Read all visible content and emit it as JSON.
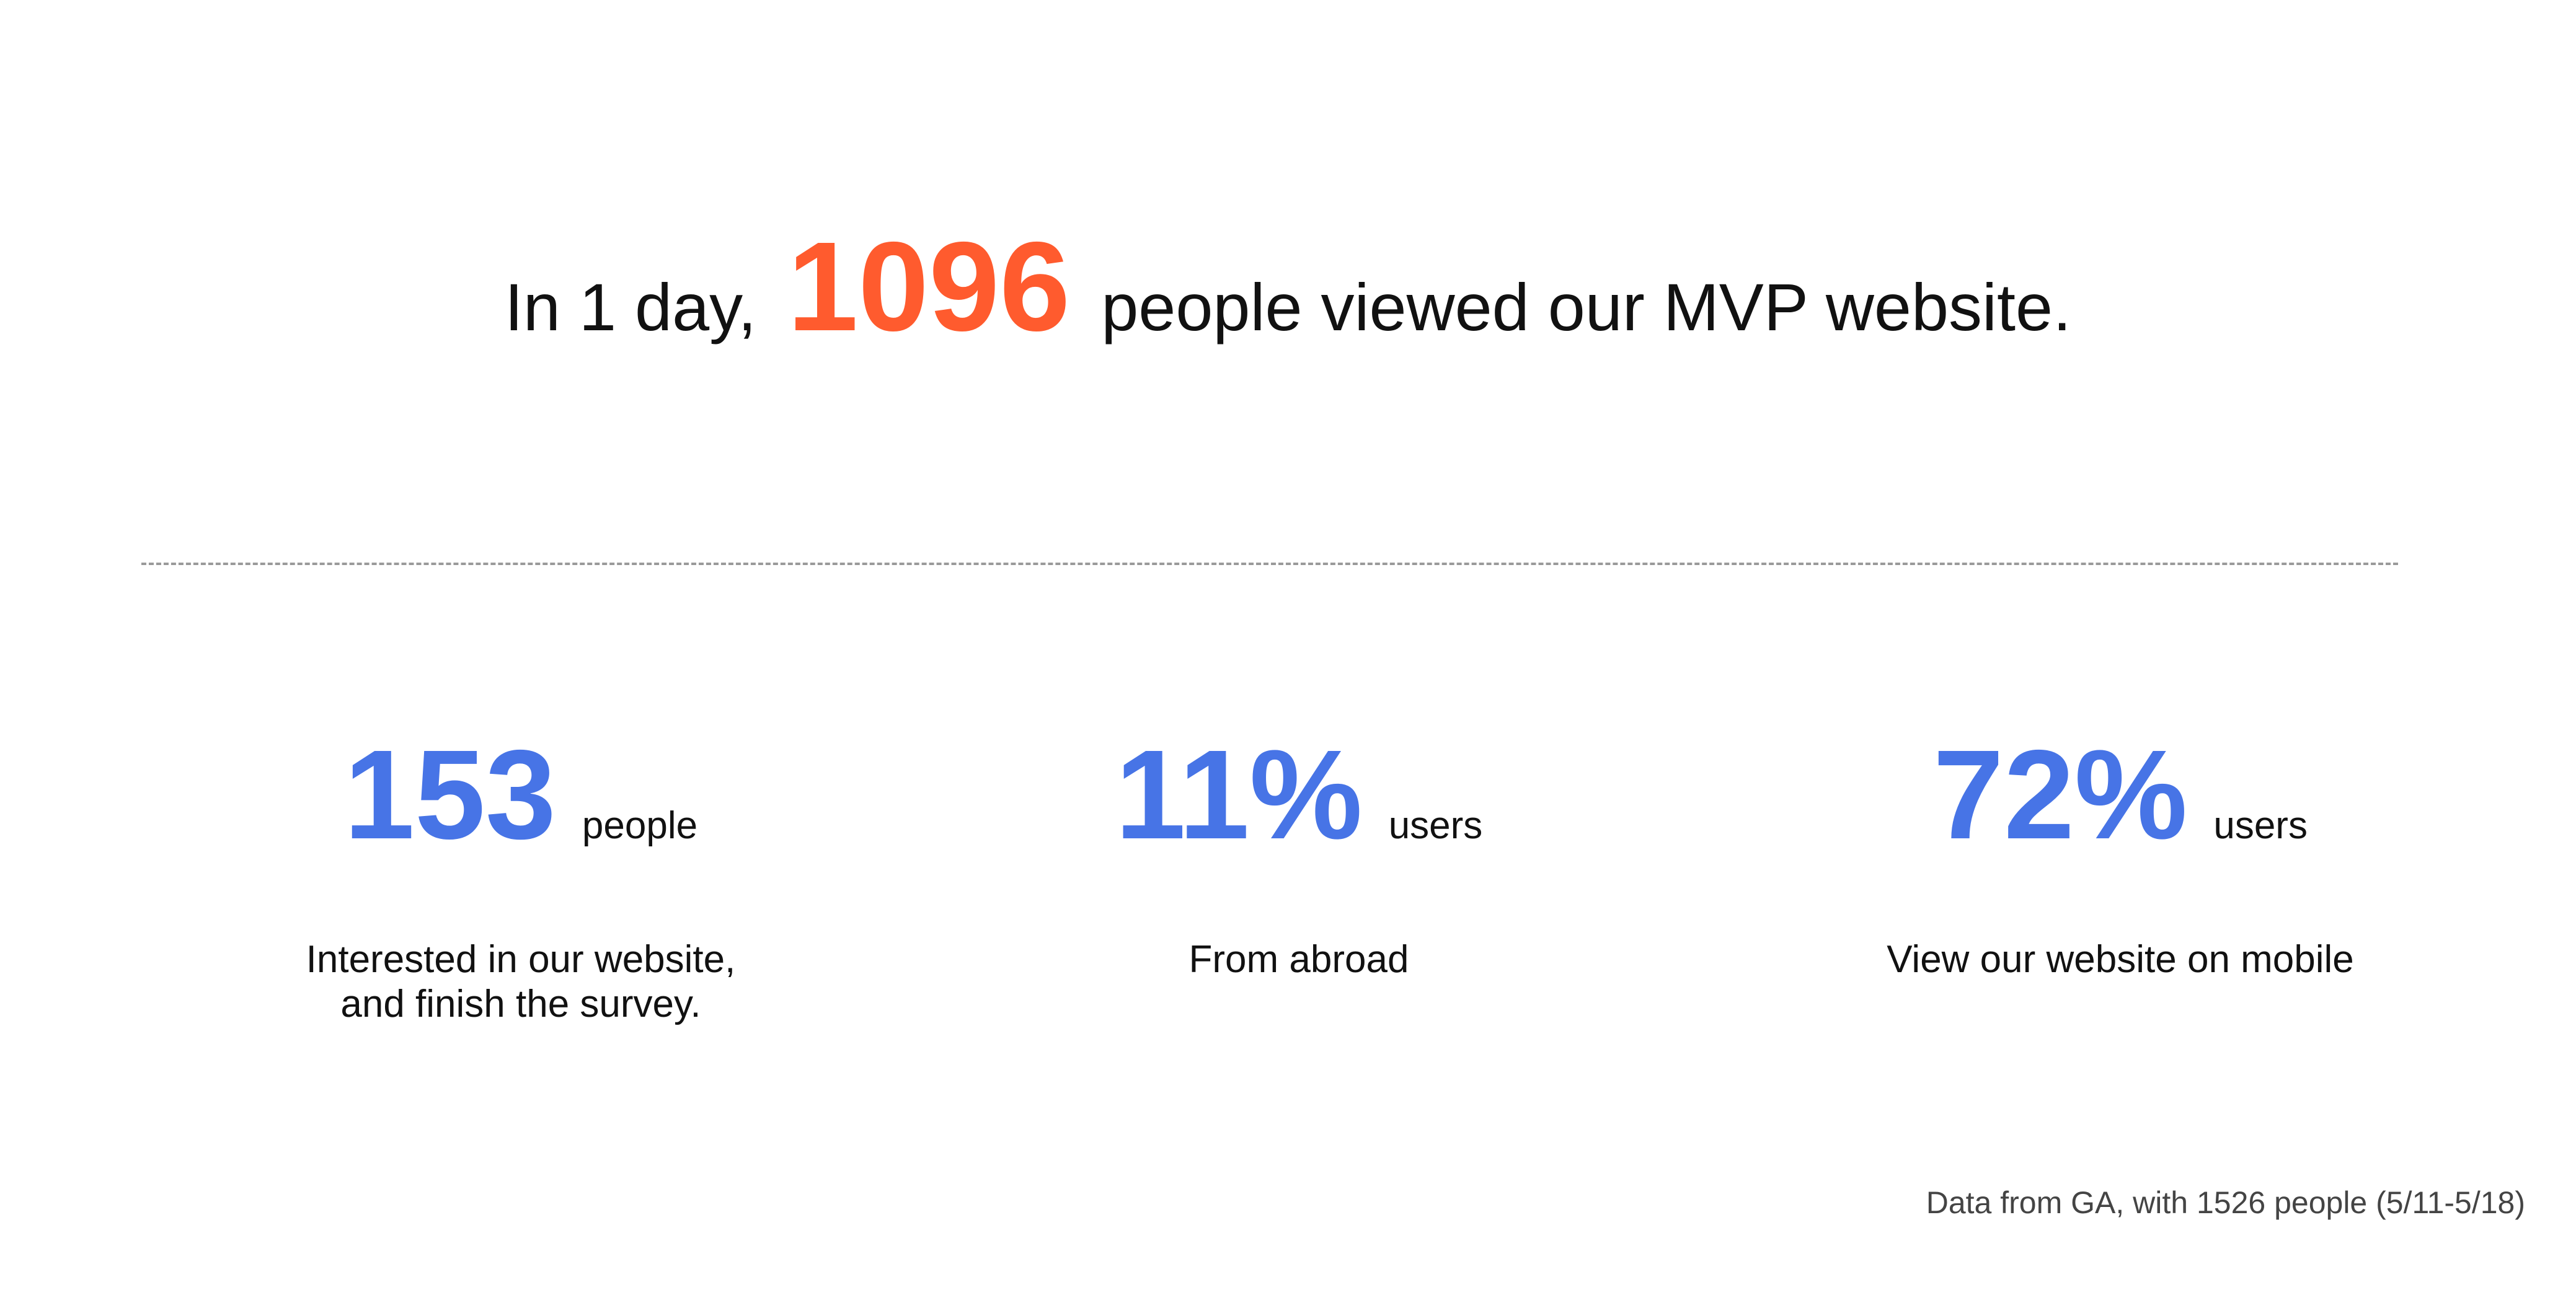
{
  "colors": {
    "highlight_orange": "#FF5B2E",
    "accent_blue": "#4774E6",
    "text": "#111111",
    "muted_text": "#444444",
    "divider": "#9A9A9A"
  },
  "headline": {
    "prefix": "In 1 day,",
    "number": "1096",
    "suffix": "people viewed our MVP website."
  },
  "stats": [
    {
      "value": "153",
      "unit": "people",
      "description": "Interested in our website,\nand finish the survey."
    },
    {
      "value": "11%",
      "unit": "users",
      "description": "From abroad"
    },
    {
      "value": "72%",
      "unit": "users",
      "description": "View our website on mobile"
    }
  ],
  "footnote": "Data from GA, with 1526 people (5/11-5/18)"
}
